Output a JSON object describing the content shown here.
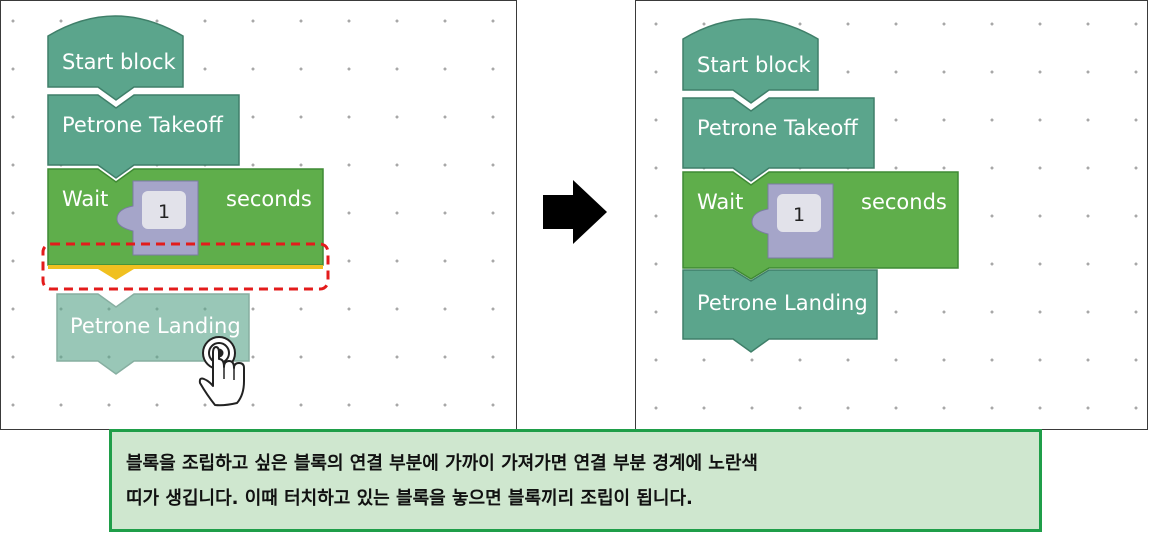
{
  "left_panel": {
    "blocks": {
      "start": "Start block",
      "takeoff": "Petrone Takeoff",
      "wait_label": "Wait",
      "wait_value": "1",
      "wait_unit": "seconds",
      "landing": "Petrone Landing"
    }
  },
  "right_panel": {
    "blocks": {
      "start": "Start block",
      "takeoff": "Petrone Takeoff",
      "wait_label": "Wait",
      "wait_value": "1",
      "wait_unit": "seconds",
      "landing": "Petrone Landing"
    }
  },
  "caption": {
    "line1": "블록을 조립하고 싶은 블록의 연결 부분에 가까이 가져가면 연결 부분 경계에 노란색",
    "line2": "띠가 생깁니다. 이때 터치하고 있는 블록을 놓으면 블록끼리 조립이 됩니다."
  },
  "colors": {
    "teal_block": "#5ba58c",
    "green_block": "#5fae4b",
    "number_socket": "#a5a5c9",
    "highlight_yellow": "#f0c020",
    "dashed_border": "#e31b1b",
    "caption_border": "#1f9e49",
    "caption_bg": "#cfe7cf"
  }
}
